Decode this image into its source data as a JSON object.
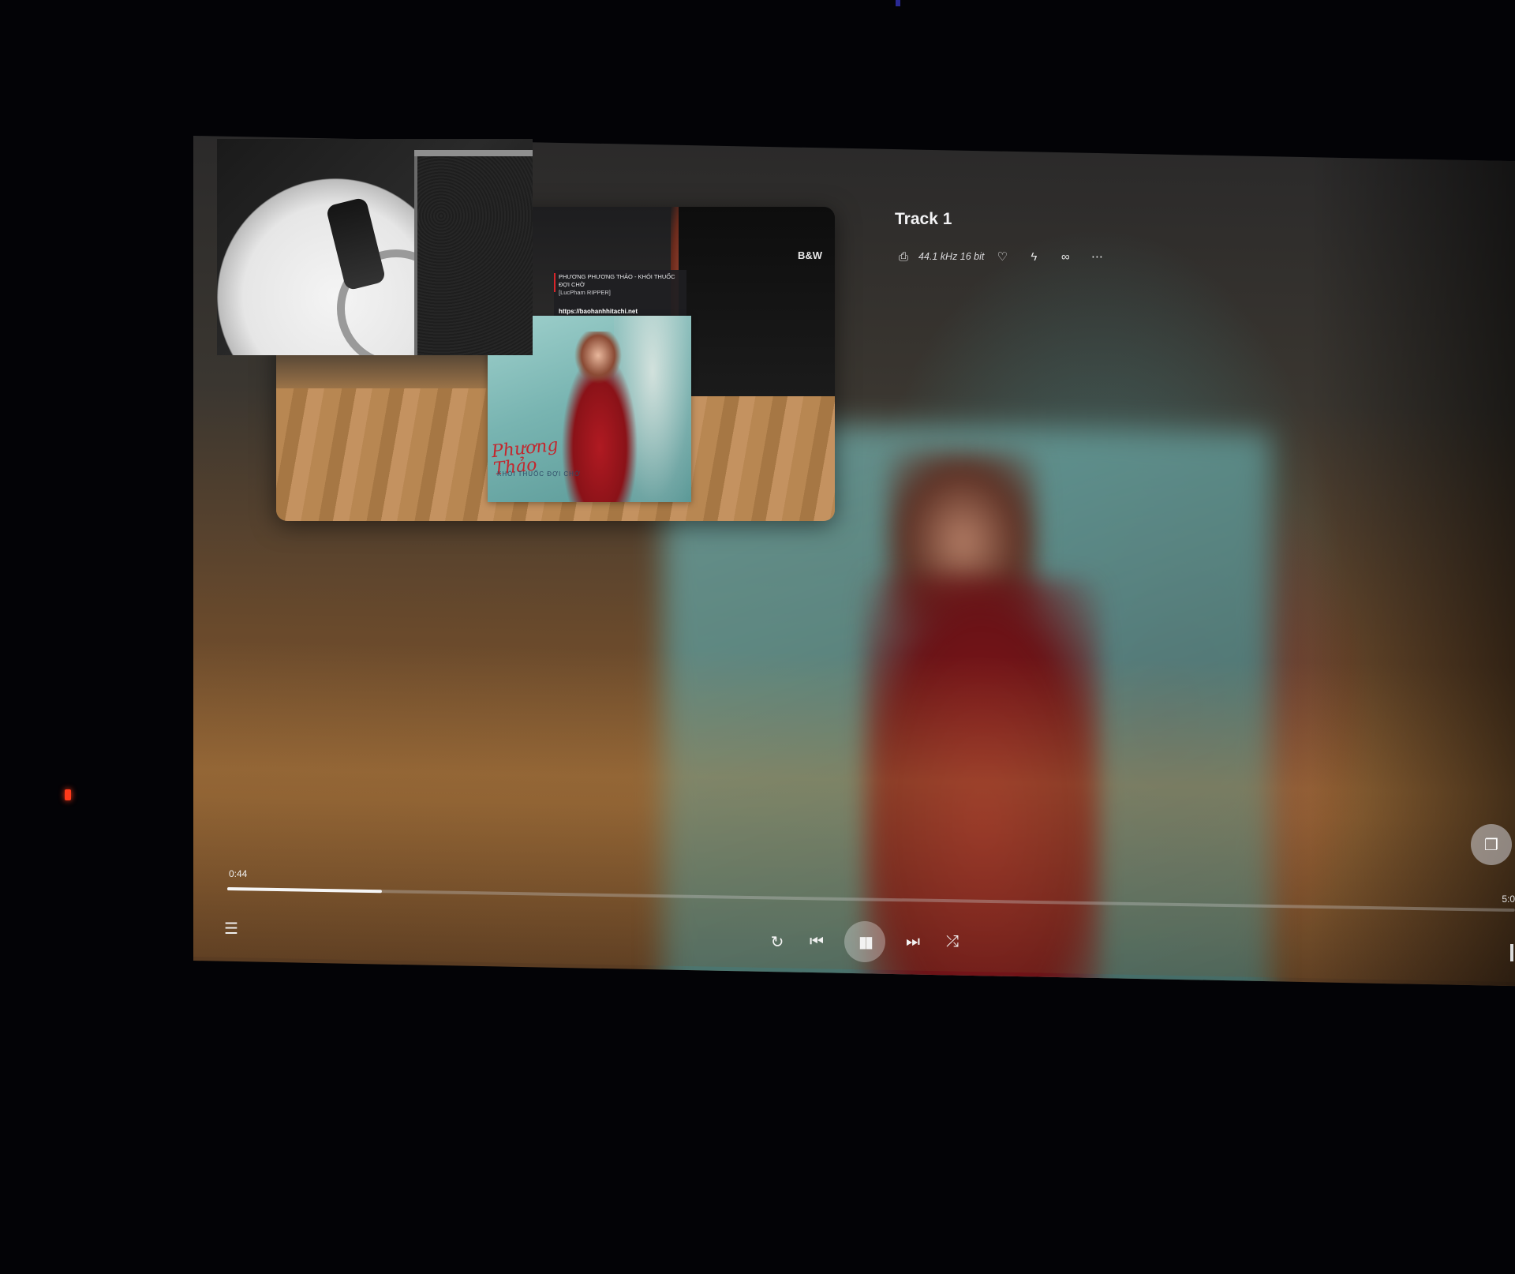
{
  "track": {
    "title": "Track 1",
    "quality": "44.1 kHz 16 bit"
  },
  "icons": {
    "device": "device-icon",
    "favorite": "heart-icon",
    "radio": "lightning-icon",
    "link": "infinity-icon",
    "more": "more-icon",
    "queue": "queue-icon",
    "repeat": "repeat-icon",
    "previous": "previous-icon",
    "play_pause": "pause-icon",
    "next": "next-icon",
    "shuffle": "shuffle-icon",
    "artwork_toggle": "artwork-icon"
  },
  "artwork": {
    "brand": "B&W",
    "strip_title": "PHƯƠNG PHƯƠNG THẢO - KHÓI THUỐC ĐỢI CHỜ",
    "strip_credit": "[LucPham RIPPER]",
    "strip_url": "https://baohanhhitachi.net",
    "cd_title": "Phương Thảo",
    "cd_subtitle": "KHÓI THUỐC ĐỢI CHỜ"
  },
  "playback": {
    "elapsed": "0:44",
    "total": "5:0",
    "progress_fraction": 0.12
  },
  "colors": {
    "accent": "#f5f5f5",
    "brand_red": "#c3262d",
    "led": "#ff3a1a"
  }
}
